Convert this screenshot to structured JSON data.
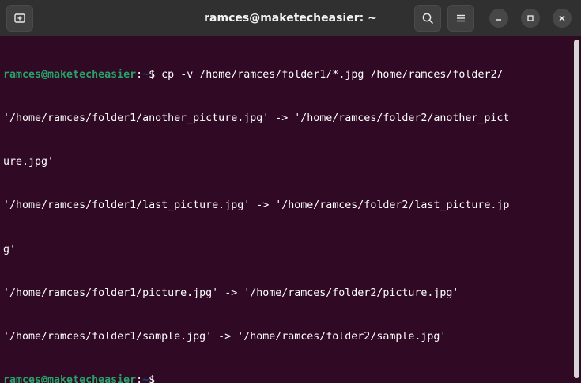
{
  "window": {
    "title": "ramces@maketecheasier: ~"
  },
  "icons": {
    "new_tab": "new-tab-icon",
    "search": "search-icon",
    "menu": "hamburger-menu-icon",
    "minimize": "minimize-icon",
    "maximize": "maximize-icon",
    "close": "close-icon"
  },
  "colors": {
    "background": "#300a24",
    "titlebar": "#303030",
    "prompt_user": "#26a269",
    "prompt_path": "#12488b",
    "text": "#ffffff"
  },
  "terminal": {
    "prompt1": {
      "user": "ramces@maketecheasier",
      "colon": ":",
      "path": "~",
      "symbol": "$ ",
      "command": "cp -v /home/ramces/folder1/*.jpg /home/ramces/folder2/"
    },
    "output": [
      "'/home/ramces/folder1/another_picture.jpg' -> '/home/ramces/folder2/another_pict",
      "ure.jpg'",
      "'/home/ramces/folder1/last_picture.jpg' -> '/home/ramces/folder2/last_picture.jp",
      "g'",
      "'/home/ramces/folder1/picture.jpg' -> '/home/ramces/folder2/picture.jpg'",
      "'/home/ramces/folder1/sample.jpg' -> '/home/ramces/folder2/sample.jpg'"
    ],
    "prompt2": {
      "user": "ramces@maketecheasier",
      "colon": ":",
      "path": "~",
      "symbol": "$"
    }
  }
}
